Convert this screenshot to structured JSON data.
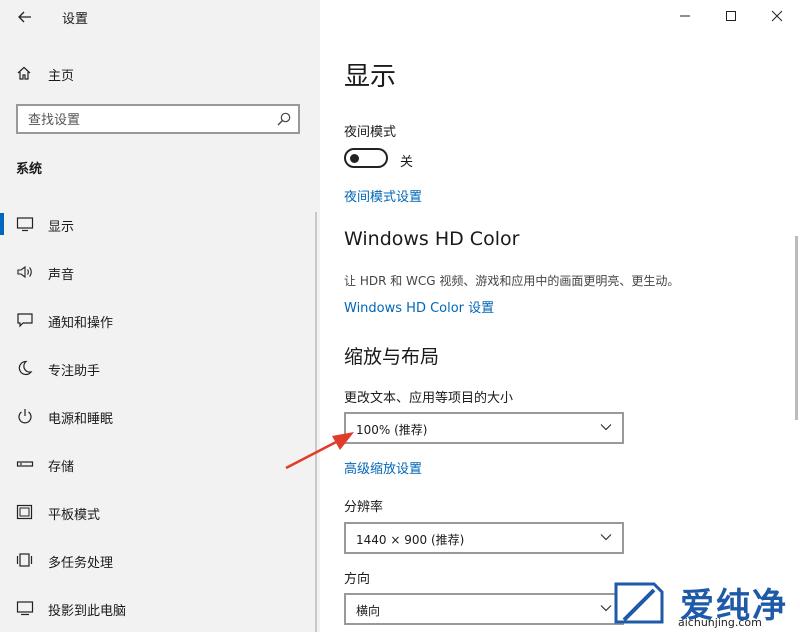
{
  "window": {
    "title": "设置",
    "controls": [
      "minimize",
      "maximize",
      "close"
    ]
  },
  "sidebar": {
    "home_label": "主页",
    "search_placeholder": "查找设置",
    "section_label": "系统",
    "items": [
      {
        "label": "显示",
        "icon": "monitor-icon",
        "active": true
      },
      {
        "label": "声音",
        "icon": "speaker-icon"
      },
      {
        "label": "通知和操作",
        "icon": "message-icon"
      },
      {
        "label": "专注助手",
        "icon": "moon-icon"
      },
      {
        "label": "电源和睡眠",
        "icon": "power-icon"
      },
      {
        "label": "存储",
        "icon": "storage-icon"
      },
      {
        "label": "平板模式",
        "icon": "tablet-icon"
      },
      {
        "label": "多任务处理",
        "icon": "multitask-icon"
      },
      {
        "label": "投影到此电脑",
        "icon": "project-icon"
      }
    ]
  },
  "main": {
    "title": "显示",
    "night_light": {
      "label": "夜间模式",
      "toggle_state": "关",
      "settings_link": "夜间模式设置"
    },
    "hd_color": {
      "heading": "Windows HD Color",
      "description": "让 HDR 和 WCG 视频、游戏和应用中的画面更明亮、更生动。",
      "settings_link": "Windows HD Color 设置"
    },
    "scale_layout": {
      "heading": "缩放与布局",
      "scale_label": "更改文本、应用等项目的大小",
      "scale_value": "100% (推荐)",
      "advanced_link": "高级缩放设置",
      "resolution_label": "分辨率",
      "resolution_value": "1440 × 900 (推荐)",
      "orientation_label": "方向",
      "orientation_value": "横向"
    }
  },
  "watermark": {
    "brand": "爱纯净",
    "url": "aichunjing.com"
  },
  "colors": {
    "sidebar_bg": "#f2f2f2",
    "accent": "#0067c0",
    "link": "#0067b8",
    "arrow": "#e23b2a"
  }
}
